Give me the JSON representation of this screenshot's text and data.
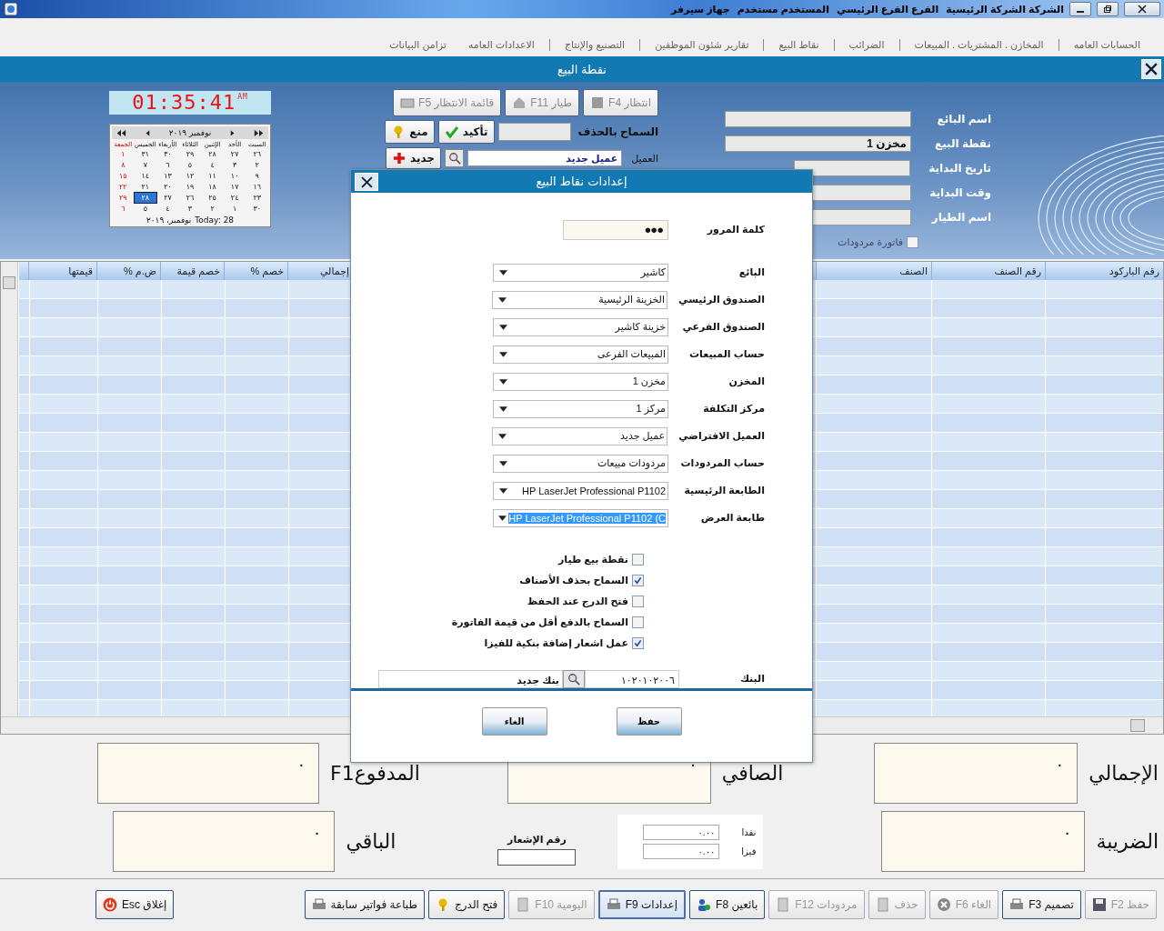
{
  "caption": {
    "items": [
      "الشركة الشركة الرئيسية",
      "الفرع الفرع الرئيسي",
      "المستخدم مستخدم",
      "جهاز سيرفر"
    ]
  },
  "menu": [
    "الحسابات العامه",
    "المخازن . المشتريات . المبيعات",
    "الضرائب",
    "نقاط البيع",
    "تقارير شئون الموظفين",
    "التصنيع والإنتاج",
    "الاعدادات العامه",
    "تزامن البيانات"
  ],
  "form_title": "نقطة البيع",
  "header_fields": [
    {
      "label": "اسم البائع"
    },
    {
      "label": "نقطة البيع",
      "value": "مخزن 1"
    },
    {
      "label": "تاريخ البداية"
    },
    {
      "label": "وقت البداية"
    },
    {
      "label": "اسم الطيار"
    }
  ],
  "returns_invoice": {
    "label": "فاتورة مردودات",
    "checked": false,
    "disabled": true
  },
  "top_buttons": [
    {
      "label": "انتظار F4",
      "disabled": true
    },
    {
      "label": "طيار F11",
      "disabled": true
    },
    {
      "label": "قائمة الانتظار F5",
      "disabled": true
    }
  ],
  "allow_delete": {
    "label": "السماح بالحذف"
  },
  "confirm_buttons": [
    {
      "label": "تأكيد",
      "disabled": false
    },
    {
      "label": "منع",
      "disabled": false
    }
  ],
  "customer": {
    "label": "العميل",
    "value": "عميل جديد",
    "new_button": "جديد"
  },
  "clock": {
    "time": "01:35:41",
    "ampm": "AM"
  },
  "calendar": {
    "month": "نوفمبر ٢٠١٩",
    "weekdays": [
      "السبت",
      "الأحد",
      "الإثنين",
      "الثلاثاء",
      "الأربعاء",
      "الخميس",
      "الجمعة"
    ],
    "weeks": [
      [
        {
          "day": "٢٦",
          "selected": false
        },
        {
          "day": "٢٧",
          "selected": false
        },
        {
          "day": "٢٨",
          "selected": false
        },
        {
          "day": "٢٩",
          "selected": false
        },
        {
          "day": "٣٠",
          "selected": false
        },
        {
          "day": "٣١",
          "selected": false
        },
        {
          "day": "١",
          "selected": false
        }
      ],
      [
        {
          "day": "٢",
          "selected": false
        },
        {
          "day": "٣",
          "selected": false
        },
        {
          "day": "٤",
          "selected": false
        },
        {
          "day": "٥",
          "selected": false
        },
        {
          "day": "٦",
          "selected": false
        },
        {
          "day": "٧",
          "selected": false
        },
        {
          "day": "٨",
          "selected": false
        }
      ],
      [
        {
          "day": "٩",
          "selected": false
        },
        {
          "day": "١٠",
          "selected": false
        },
        {
          "day": "١١",
          "selected": false
        },
        {
          "day": "١٢",
          "selected": false
        },
        {
          "day": "١٣",
          "selected": false
        },
        {
          "day": "١٤",
          "selected": false
        },
        {
          "day": "١٥",
          "selected": false
        }
      ],
      [
        {
          "day": "١٦",
          "selected": false
        },
        {
          "day": "١٧",
          "selected": false
        },
        {
          "day": "١٨",
          "selected": false
        },
        {
          "day": "١٩",
          "selected": false
        },
        {
          "day": "٢٠",
          "selected": false
        },
        {
          "day": "٢١",
          "selected": false
        },
        {
          "day": "٢٢",
          "selected": false
        }
      ],
      [
        {
          "day": "٢٣",
          "selected": false
        },
        {
          "day": "٢٤",
          "selected": false
        },
        {
          "day": "٢٥",
          "selected": false
        },
        {
          "day": "٢٦",
          "selected": false
        },
        {
          "day": "٢٧",
          "selected": false
        },
        {
          "day": "٢٨",
          "selected": true
        },
        {
          "day": "٢٩",
          "selected": false
        }
      ],
      [
        {
          "day": "٣٠",
          "selected": false
        },
        {
          "day": "١",
          "selected": false
        },
        {
          "day": "٢",
          "selected": false
        },
        {
          "day": "٣",
          "selected": false
        },
        {
          "day": "٤",
          "selected": false
        },
        {
          "day": "٥",
          "selected": false
        },
        {
          "day": "٦",
          "selected": false
        }
      ]
    ],
    "today_label": "Today: 28",
    "today_date": "نوفمبر، ٢٠١٩"
  },
  "table": {
    "columns": [
      "رقم الباركود",
      "رقم الصنف",
      "الصنف",
      "إجمالي",
      "خصم %",
      "خصم قيمة",
      "ض.م %",
      "قيمتها"
    ]
  },
  "totals": {
    "total": {
      "label": "الإجمالي",
      "value": "٠"
    },
    "net": {
      "label": "الصافي",
      "value": "٠"
    },
    "paid": {
      "label": "المدفوعF1",
      "value": "٠"
    },
    "tax": {
      "label": "الضريبة",
      "value": "٠"
    },
    "remaining": {
      "label": "الباقي",
      "value": "٠"
    },
    "cash": {
      "label": "نقدا",
      "value": "٠.٠٠"
    },
    "visa": {
      "label": "فيزا",
      "value": "٠.٠٠"
    },
    "notice": {
      "label": "رقم الإشعار"
    }
  },
  "bottom_buttons": [
    {
      "label": "حفظ F2",
      "disabled": true,
      "focused": false
    },
    {
      "label": "تصميم F3",
      "disabled": false,
      "focused": false
    },
    {
      "label": "الغاء F6",
      "disabled": true,
      "focused": false
    },
    {
      "label": "حذف",
      "disabled": true,
      "focused": false
    },
    {
      "label": "مردودات F12",
      "disabled": true,
      "focused": false
    },
    {
      "label": "بائعين F8",
      "disabled": false,
      "focused": false
    },
    {
      "label": "إعدادات F9",
      "disabled": false,
      "focused": true
    },
    {
      "label": "اليومية F10",
      "disabled": true,
      "focused": false
    },
    {
      "label": "فتح الدرج",
      "disabled": false,
      "focused": false
    },
    {
      "label": "طباعة فواتير سابقة",
      "disabled": false,
      "focused": false
    }
  ],
  "close_button": "إغلاق Esc",
  "dialog": {
    "title": "إعدادات نقاط البيع",
    "password": {
      "label": "كلمة المرور",
      "value": "●●●"
    },
    "fields": [
      {
        "label": "البائع",
        "value": "كاشير",
        "selected": false
      },
      {
        "label": "الصندوق الرئيسي",
        "value": "الخزينة الرئيسية",
        "selected": false
      },
      {
        "label": "الصندوق الفرعي",
        "value": "خزينة كاشير",
        "selected": false
      },
      {
        "label": "حساب المبيعات",
        "value": "المبيعات الفرعى",
        "selected": false
      },
      {
        "label": "المخزن",
        "value": "مخزن 1",
        "selected": false
      },
      {
        "label": "مركز التكلفة",
        "value": "مركز 1",
        "selected": false
      },
      {
        "label": "العميل الافتراضي",
        "value": "عميل جديد",
        "selected": false
      },
      {
        "label": "حساب المردودات",
        "value": "مردودات مبيعات",
        "selected": false
      },
      {
        "label": "الطابعة الرئيسية",
        "value": "HP LaserJet Professional P1102",
        "selected": false
      },
      {
        "label": "طابعة العرض",
        "value": "HP LaserJet Professional P1102 (C",
        "selected": true
      }
    ],
    "options": [
      {
        "label": "نقطة بيع طيار",
        "checked": false
      },
      {
        "label": "السماح بحذف الأصناف",
        "checked": true
      },
      {
        "label": "فتح الدرج عند الحفظ",
        "checked": false
      },
      {
        "label": "السماح بالدفع أقل من قيمة الفاتورة",
        "checked": false
      },
      {
        "label": "عمل اشعار إضافة بنكية للفيزا",
        "checked": true
      }
    ],
    "bank": {
      "label": "البنك",
      "code": "١٠٢٠١٠٢٠٠٦",
      "name": "بنك جديد"
    },
    "buttons": [
      "حفظ",
      "الغاء"
    ]
  }
}
